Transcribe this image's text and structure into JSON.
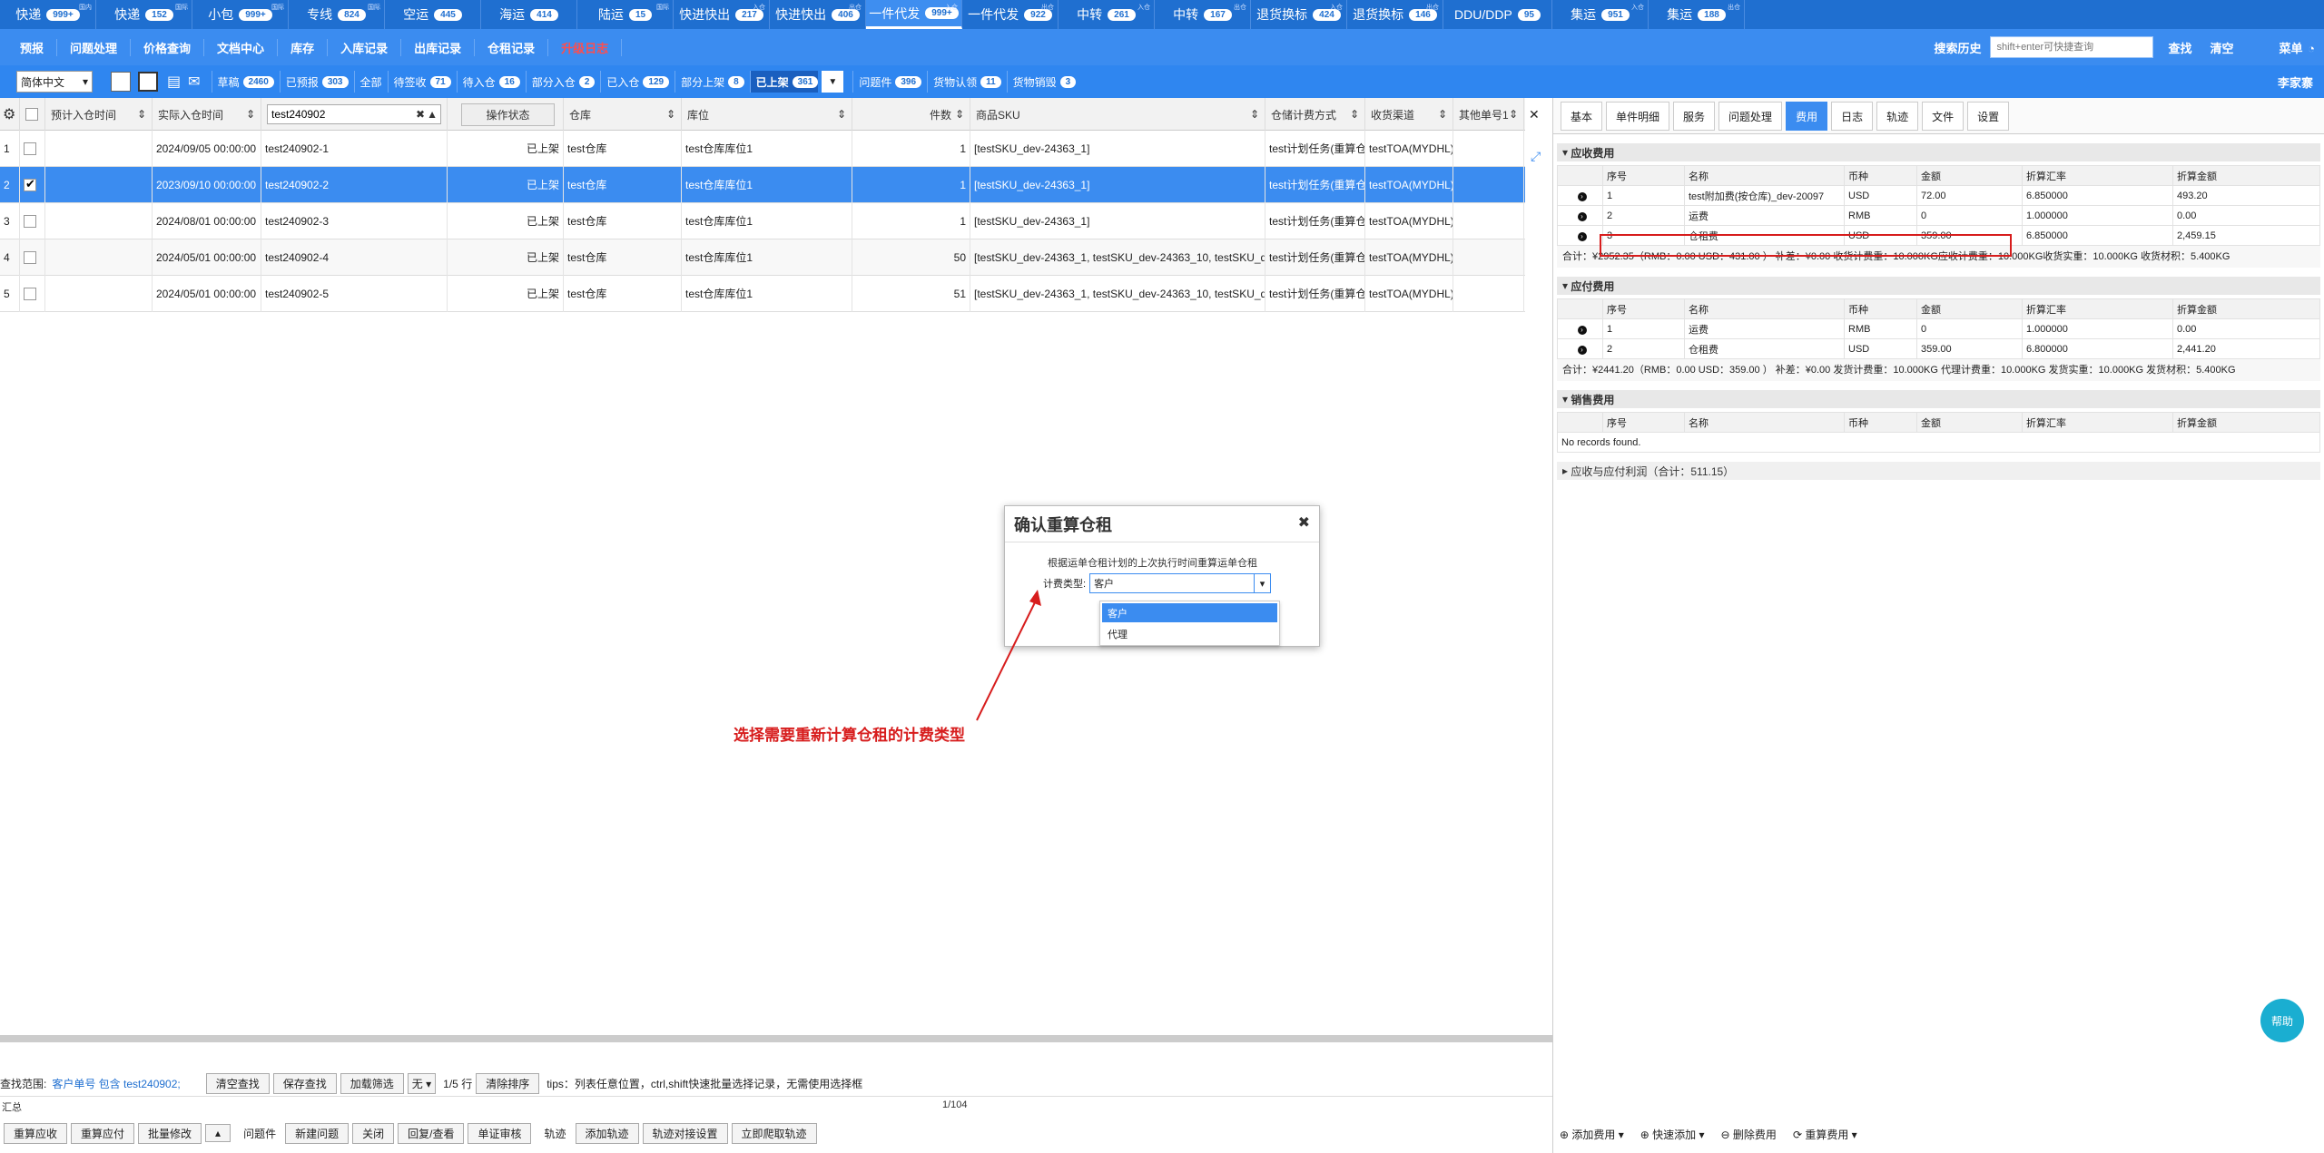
{
  "top_tabs": [
    {
      "label": "快递",
      "badge": "999+",
      "sup": "国内"
    },
    {
      "label": "快递",
      "badge": "152",
      "sup": "国际"
    },
    {
      "label": "小包",
      "badge": "999+",
      "sup": "国际"
    },
    {
      "label": "专线",
      "badge": "824",
      "sup": "国际"
    },
    {
      "label": "空运",
      "badge": "445",
      "sup": ""
    },
    {
      "label": "海运",
      "badge": "414",
      "sup": ""
    },
    {
      "label": "陆运",
      "badge": "15",
      "sup": "国际"
    },
    {
      "label": "快进快出",
      "badge": "217",
      "sup": "入仓"
    },
    {
      "label": "快进快出",
      "badge": "406",
      "sup": "出仓"
    },
    {
      "label": "一件代发",
      "badge": "999+",
      "sup": "入仓"
    },
    {
      "label": "一件代发",
      "badge": "922",
      "sup": "出仓"
    },
    {
      "label": "中转",
      "badge": "261",
      "sup": "入仓"
    },
    {
      "label": "中转",
      "badge": "167",
      "sup": "出仓"
    },
    {
      "label": "退货换标",
      "badge": "424",
      "sup": "入仓"
    },
    {
      "label": "退货换标",
      "badge": "146",
      "sup": "出仓"
    },
    {
      "label": "DDU/DDP",
      "badge": "95",
      "sup": ""
    },
    {
      "label": "集运",
      "badge": "951",
      "sup": "入仓"
    },
    {
      "label": "集运",
      "badge": "188",
      "sup": "出仓"
    }
  ],
  "menu": {
    "items": [
      "预报",
      "问题处理",
      "价格查询",
      "文档中心",
      "库存",
      "入库记录",
      "出库记录",
      "仓租记录",
      "升级日志"
    ],
    "search_history": "搜索历史",
    "search_placeholder": "shift+enter可快捷查询",
    "search": "查找",
    "clear": "清空",
    "menu": "菜单"
  },
  "filter": {
    "lang": "简体中文",
    "username": "李家寨",
    "buttons": [
      {
        "label": "草稿",
        "badge": "2460"
      },
      {
        "label": "已预报",
        "badge": "303"
      },
      {
        "label": "全部",
        "badge": ""
      },
      {
        "label": "待签收",
        "badge": "71"
      },
      {
        "label": "待入仓",
        "badge": "16"
      },
      {
        "label": "部分入仓",
        "badge": "2"
      },
      {
        "label": "已入仓",
        "badge": "129"
      },
      {
        "label": "部分上架",
        "badge": "8"
      },
      {
        "label": "已上架",
        "badge": "361"
      },
      {
        "label": "问题件",
        "badge": "396"
      },
      {
        "label": "货物认领",
        "badge": "11"
      },
      {
        "label": "货物销毁",
        "badge": "3"
      }
    ]
  },
  "grid": {
    "headers": [
      "预计入仓时间",
      "实际入仓时间",
      "test240902",
      "操作状态",
      "仓库",
      "库位",
      "件数",
      "商品SKU",
      "仓储计费方式",
      "收货渠道",
      "其他单号1"
    ],
    "rows": [
      {
        "no": "1",
        "est": "",
        "act": "2024/09/05 00:00:00",
        "order": "test240902-1",
        "status": "已上架",
        "wh": "test仓库",
        "loc": "test仓库库位1",
        "qty": "1",
        "sku": "[testSKU_dev-24363_1]",
        "bill": "test计划任务(重算仓",
        "ch": "testTOA(MYDHL)",
        "other": ""
      },
      {
        "no": "2",
        "est": "",
        "act": "2023/09/10 00:00:00",
        "order": "test240902-2",
        "status": "已上架",
        "wh": "test仓库",
        "loc": "test仓库库位1",
        "qty": "1",
        "sku": "[testSKU_dev-24363_1]",
        "bill": "test计划任务(重算仓",
        "ch": "testTOA(MYDHL)",
        "other": ""
      },
      {
        "no": "3",
        "est": "",
        "act": "2024/08/01 00:00:00",
        "order": "test240902-3",
        "status": "已上架",
        "wh": "test仓库",
        "loc": "test仓库库位1",
        "qty": "1",
        "sku": "[testSKU_dev-24363_1]",
        "bill": "test计划任务(重算仓",
        "ch": "testTOA(MYDHL)",
        "other": ""
      },
      {
        "no": "4",
        "est": "",
        "act": "2024/05/01 00:00:00",
        "order": "test240902-4",
        "status": "已上架",
        "wh": "test仓库",
        "loc": "test仓库库位1",
        "qty": "50",
        "sku": "[testSKU_dev-24363_1, testSKU_dev-24363_10, testSKU_d",
        "bill": "test计划任务(重算仓",
        "ch": "testTOA(MYDHL)",
        "other": ""
      },
      {
        "no": "5",
        "est": "",
        "act": "2024/05/01 00:00:00",
        "order": "test240902-5",
        "status": "已上架",
        "wh": "test仓库",
        "loc": "test仓库库位1",
        "qty": "51",
        "sku": "[testSKU_dev-24363_1, testSKU_dev-24363_10, testSKU_d",
        "bill": "test计划任务(重算仓",
        "ch": "testTOA(MYDHL)",
        "other": ""
      }
    ]
  },
  "right": {
    "tabs": [
      "基本",
      "单件明细",
      "服务",
      "问题处理",
      "费用",
      "日志",
      "轨迹",
      "文件",
      "设置"
    ],
    "active_tab": "费用",
    "cols": [
      "序号",
      "名称",
      "币种",
      "金额",
      "折算汇率",
      "折算金额"
    ],
    "receivable": {
      "title": "应收费用",
      "rows": [
        [
          "1",
          "test附加费(按仓库)_dev-20097",
          "USD",
          "72.00",
          "6.850000",
          "493.20"
        ],
        [
          "2",
          "运费",
          "RMB",
          "0",
          "1.000000",
          "0.00"
        ],
        [
          "3",
          "仓租费",
          "USD",
          "359.00",
          "6.850000",
          "2,459.15"
        ]
      ],
      "summary": "合计：¥2952.35（RMB：0.00 USD：431.00 ）   补差：¥0.00   收货计费重：10.000KG应收计费重：10.000KG收货实重：10.000KG 收货材积：5.400KG"
    },
    "payable": {
      "title": "应付费用",
      "rows": [
        [
          "1",
          "运费",
          "RMB",
          "0",
          "1.000000",
          "0.00"
        ],
        [
          "2",
          "仓租费",
          "USD",
          "359.00",
          "6.800000",
          "2,441.20"
        ]
      ],
      "summary": "合计：¥2441.20（RMB：0.00 USD：359.00 ）   补差：¥0.00   发货计费重：10.000KG 代理计费重：10.000KG 发货实重：10.000KG 发货材积：5.400KG"
    },
    "sales": {
      "title": "销售费用",
      "empty": "No records found."
    },
    "profit": "应收与应付利润（合计：511.15）",
    "bottom": [
      "添加费用",
      "快速添加",
      "删除费用",
      "重算费用"
    ]
  },
  "dialog": {
    "title": "确认重算仓租",
    "message": "根据运单仓租计划的上次执行时间重算运单仓租",
    "label": "计费类型:",
    "value": "客户",
    "options": [
      "客户",
      "代理"
    ]
  },
  "annotation": "选择需要重新计算仓租的计费类型",
  "bottom": {
    "scope_label": "查找范围:",
    "scope_value": "客户单号 包含 test240902;",
    "buttons1": [
      "清空查找",
      "保存查找",
      "加载筛选"
    ],
    "none": "无",
    "rows": "1/5 行",
    "clear_sort": "清除排序",
    "tips": "tips：列表任意位置，ctrl,shift快速批量选择记录，无需使用选择框",
    "summary_label": "汇总",
    "page": "1/104",
    "buttons3": [
      "重算应收",
      "重算应付",
      "批量修改",
      "问题件",
      "新建问题",
      "关闭",
      "回复/查看",
      "单证审核",
      "轨迹",
      "添加轨迹",
      "轨迹对接设置",
      "立即爬取轨迹"
    ]
  },
  "help": "帮助"
}
